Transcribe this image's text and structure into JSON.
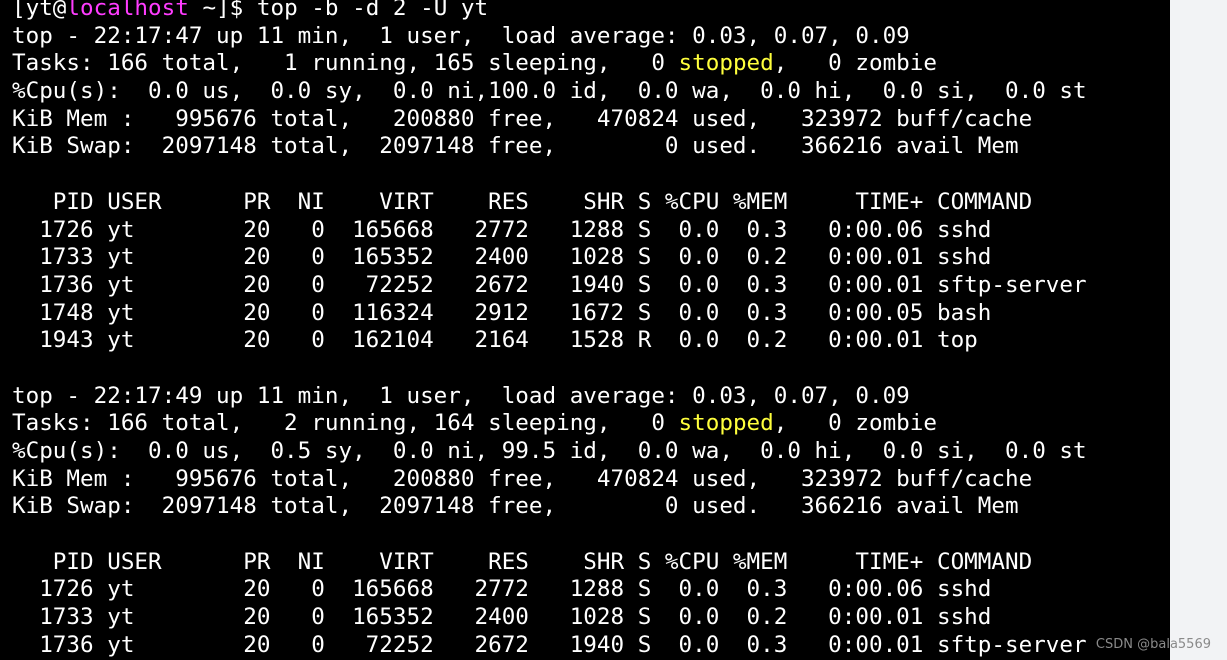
{
  "terminal": {
    "prompt": {
      "user": "yt",
      "host": "localhost",
      "cwd": "~",
      "command": "top -b -d 2 -U yt"
    },
    "lines": [
      [
        {
          "t": "[yt@"
        },
        {
          "t": "localhost",
          "c": "magenta"
        },
        {
          "t": " ~]$ top -b -d 2 -U yt"
        }
      ],
      [
        {
          "t": "top - 22:17:47 up 11 min,  1 user,  load average: 0.03, 0.07, 0.09"
        }
      ],
      [
        {
          "t": "Tasks: 166 total,   1 running, 165 sleeping,   0 "
        },
        {
          "t": "stopped",
          "c": "yellow"
        },
        {
          "t": ",   0 zombie"
        }
      ],
      [
        {
          "t": "%Cpu(s):  0.0 us,  0.0 sy,  0.0 ni,100.0 id,  0.0 wa,  0.0 hi,  0.0 si,  0.0 st"
        }
      ],
      [
        {
          "t": "KiB Mem :   995676 total,   200880 free,   470824 used,   323972 buff/cache"
        }
      ],
      [
        {
          "t": "KiB Swap:  2097148 total,  2097148 free,        0 used.   366216 avail Mem"
        }
      ],
      [
        {
          "t": ""
        }
      ],
      [
        {
          "t": "   PID USER      PR  NI    VIRT    RES    SHR S %CPU %MEM     TIME+ COMMAND"
        }
      ],
      [
        {
          "t": "  1726 yt        20   0  165668   2772   1288 S  0.0  0.3   0:00.06 sshd"
        }
      ],
      [
        {
          "t": "  1733 yt        20   0  165352   2400   1028 S  0.0  0.2   0:00.01 sshd"
        }
      ],
      [
        {
          "t": "  1736 yt        20   0   72252   2672   1940 S  0.0  0.3   0:00.01 sftp-server"
        }
      ],
      [
        {
          "t": "  1748 yt        20   0  116324   2912   1672 S  0.0  0.3   0:00.05 bash"
        }
      ],
      [
        {
          "t": "  1943 yt        20   0  162104   2164   1528 R  0.0  0.2   0:00.01 top"
        }
      ],
      [
        {
          "t": ""
        }
      ],
      [
        {
          "t": "top - 22:17:49 up 11 min,  1 user,  load average: 0.03, 0.07, 0.09"
        }
      ],
      [
        {
          "t": "Tasks: 166 total,   2 running, 164 sleeping,   0 "
        },
        {
          "t": "stopped",
          "c": "yellow"
        },
        {
          "t": ",   0 zombie"
        }
      ],
      [
        {
          "t": "%Cpu(s):  0.0 us,  0.5 sy,  0.0 ni, 99.5 id,  0.0 wa,  0.0 hi,  0.0 si,  0.0 st"
        }
      ],
      [
        {
          "t": "KiB Mem :   995676 total,   200880 free,   470824 used,   323972 buff/cache"
        }
      ],
      [
        {
          "t": "KiB Swap:  2097148 total,  2097148 free,        0 used.   366216 avail Mem"
        }
      ],
      [
        {
          "t": ""
        }
      ],
      [
        {
          "t": "   PID USER      PR  NI    VIRT    RES    SHR S %CPU %MEM     TIME+ COMMAND"
        }
      ],
      [
        {
          "t": "  1726 yt        20   0  165668   2772   1288 S  0.0  0.3   0:00.06 sshd"
        }
      ],
      [
        {
          "t": "  1733 yt        20   0  165352   2400   1028 S  0.0  0.2   0:00.01 sshd"
        }
      ],
      [
        {
          "t": "  1736 yt        20   0   72252   2672   1940 S  0.0  0.3   0:00.01 sftp-server"
        }
      ]
    ]
  },
  "colors": {
    "background": "#000000",
    "text": "#ffffff",
    "hostname": "#ff3cff",
    "stopped": "#ffff3c"
  },
  "watermark": "CSDN @bala5569"
}
